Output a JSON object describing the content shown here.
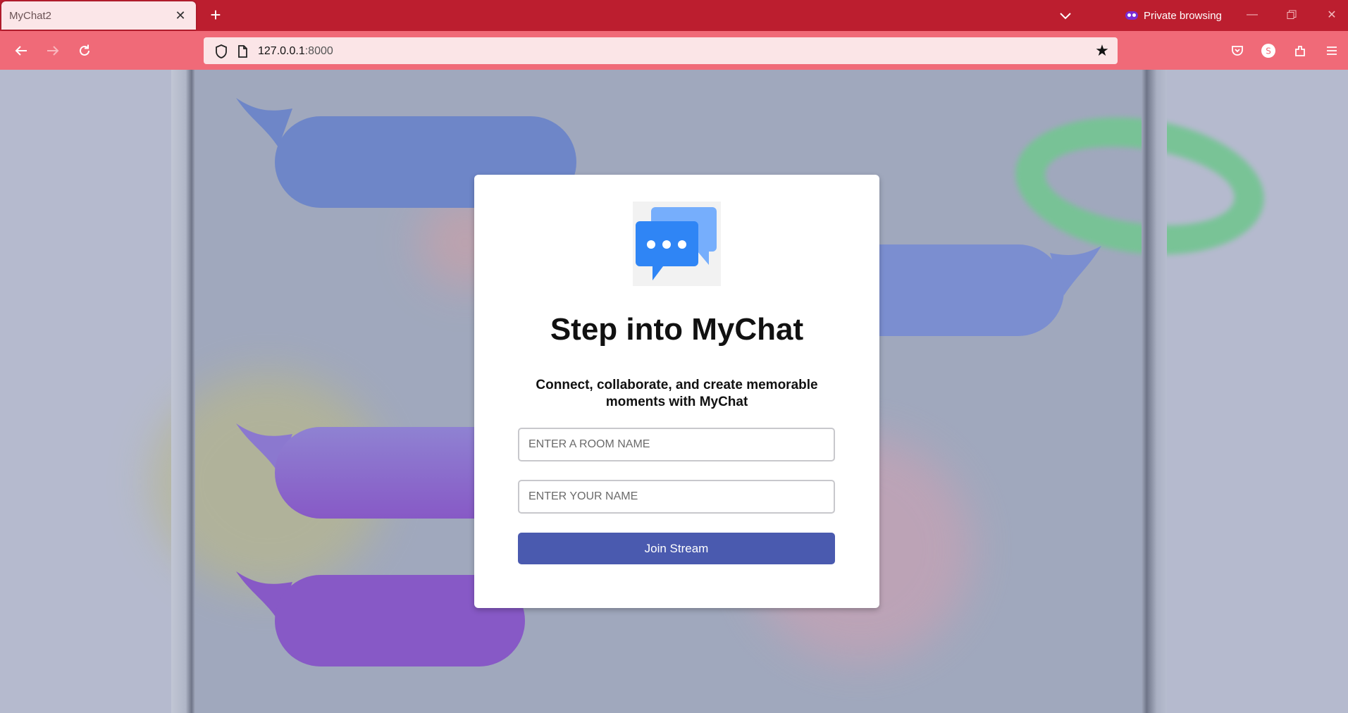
{
  "browser": {
    "tab_title": "MyChat2",
    "private_label": "Private browsing",
    "url_host": "127.0.0.1",
    "url_port": ":8000",
    "colors": {
      "tabbar": "#bc1e2f",
      "navbar": "#f06a78",
      "urlbar": "#fbe5e7"
    }
  },
  "card": {
    "title": "Step into MyChat",
    "subtitle": "Connect, collaborate, and create memorable moments with MyChat",
    "room_placeholder": "ENTER A ROOM NAME",
    "name_placeholder": "ENTER YOUR NAME",
    "room_value": "",
    "name_value": "",
    "join_label": "Join Stream",
    "accent_color": "#4a5aaf"
  },
  "icons": {
    "logo": "chat-bubbles-icon",
    "back": "back-arrow-icon",
    "forward": "forward-arrow-icon",
    "reload": "reload-icon",
    "shield": "shield-icon",
    "page": "page-icon",
    "bookmark": "star-icon",
    "pocket": "pocket-icon",
    "account": "account-icon",
    "extensions": "extensions-icon",
    "menu": "hamburger-menu-icon"
  }
}
